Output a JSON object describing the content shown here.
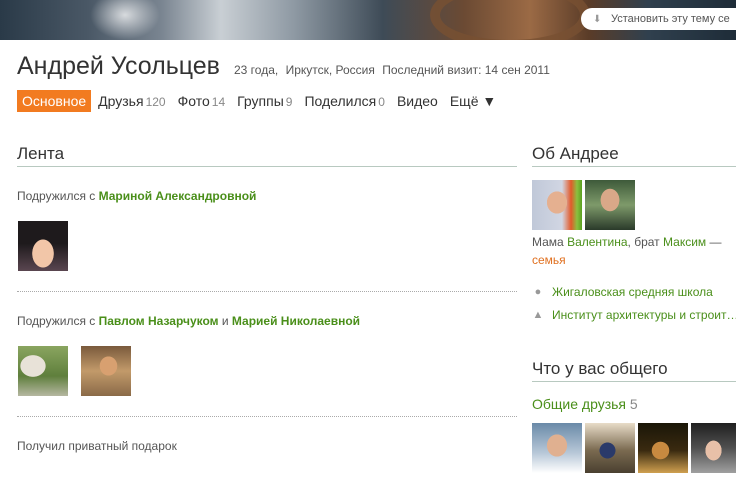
{
  "banner": {
    "install_theme_label": "Установить эту тему се",
    "download_icon": "download-icon"
  },
  "profile": {
    "name": "Андрей Усольцев",
    "age": "23 года,",
    "location": "Иркутск, Россия",
    "last_visit": "Последний визит: 14 сен 2011"
  },
  "nav": {
    "main": "Основное",
    "friends": "Друзья",
    "friends_count": "120",
    "photos": "Фото",
    "photos_count": "14",
    "groups": "Группы",
    "groups_count": "9",
    "shared": "Поделился",
    "shared_count": "0",
    "video": "Видео",
    "more": "Ещё ▼"
  },
  "feed": {
    "title": "Лента",
    "item1": {
      "prefix": "Подружился с ",
      "friend": "Мариной Александровной"
    },
    "item2": {
      "prefix": "Подружился с ",
      "friend1": "Павлом Назарчуком",
      "joiner": " и ",
      "friend2": "Марией Николаевной"
    },
    "item3": {
      "text": "Получил приватный подарок"
    }
  },
  "about": {
    "title": "Об Андрее",
    "mom_label": "Мама ",
    "mom_name": "Валентина",
    "brother_label": ", брат ",
    "brother_name": "Максим",
    "dash": " —",
    "family_link": "семья",
    "school": "Жигаловская средняя школа",
    "school_icon": "school-icon",
    "institute": "Институт архитектуры и строит…",
    "institute_icon": "graduation-cap-icon"
  },
  "common": {
    "title": "Что у вас общего",
    "friends_label": "Общие друзья",
    "friends_count": "5"
  },
  "colors": {
    "accent": "#f27b20",
    "link_green": "#4a8f1a"
  }
}
